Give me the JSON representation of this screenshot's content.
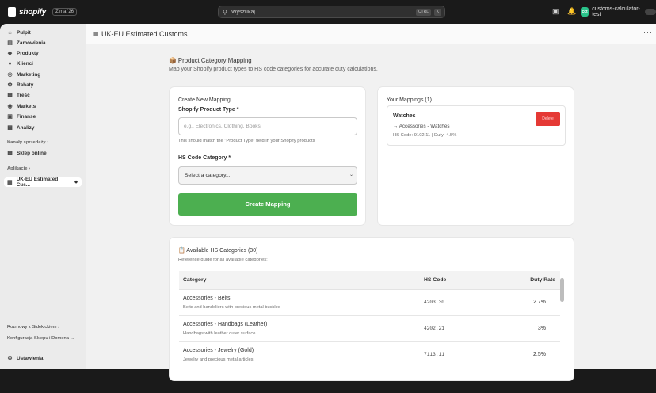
{
  "topbar": {
    "brand": "shopify",
    "edition": "Zima '26",
    "search_placeholder": "Wyszukaj",
    "kbd1": "CTRL",
    "kbd2": "K",
    "store_initials": "cct",
    "store_name": "customs-calculator-test"
  },
  "sidebar": {
    "items": [
      {
        "label": "Pulpit",
        "icon": "home-icon"
      },
      {
        "label": "Zamówienia",
        "icon": "orders-icon"
      },
      {
        "label": "Produkty",
        "icon": "tag-icon"
      },
      {
        "label": "Klienci",
        "icon": "person-icon"
      },
      {
        "label": "Marketing",
        "icon": "target-icon"
      },
      {
        "label": "Rabaty",
        "icon": "discount-icon"
      },
      {
        "label": "Treść",
        "icon": "content-icon"
      },
      {
        "label": "Markets",
        "icon": "globe-icon"
      },
      {
        "label": "Finanse",
        "icon": "bank-icon"
      },
      {
        "label": "Analizy",
        "icon": "chart-icon"
      }
    ],
    "sales_channels_header": "Kanały sprzedaży",
    "online_store": "Sklep online",
    "apps_header": "Aplikacje",
    "active_app": "UK-EU Estimated Cus...",
    "sidekick": "Rozmowy z Sidekickiem",
    "config": "Konfiguracja Sklepu i Domena ...",
    "settings": "Ustawienia"
  },
  "header": {
    "title": "UK-EU Estimated Customs"
  },
  "section": {
    "title": "Product Category Mapping",
    "description": "Map your Shopify product types to HS code categories for accurate duty calculations."
  },
  "create_form": {
    "heading": "Create New Mapping",
    "product_type_label": "Shopify Product Type *",
    "product_type_placeholder": "e.g., Electronics, Clothing, Books",
    "product_type_help": "This should match the \"Product Type\" field in your Shopify products",
    "category_label": "HS Code Category *",
    "category_selected": "Select a category...",
    "submit_label": "Create Mapping"
  },
  "mappings": {
    "heading": "Your Mappings (1)",
    "items": [
      {
        "name": "Watches",
        "category": "→ Accessories - Watches",
        "details": "HS Code: 9102.11 | Duty: 4.5%",
        "delete_label": "Delete"
      }
    ]
  },
  "hs_categories": {
    "heading": "Available HS Categories (30)",
    "subheading": "Reference guide for all available categories:",
    "columns": [
      "Category",
      "HS Code",
      "Duty Rate"
    ],
    "rows": [
      {
        "name": "Accessories - Belts",
        "desc": "Belts and bandoliers with precious metal buckles",
        "code": "4203.30",
        "rate": "2.7%"
      },
      {
        "name": "Accessories - Handbags (Leather)",
        "desc": "Handbags with leather outer surface",
        "code": "4202.21",
        "rate": "3%"
      },
      {
        "name": "Accessories - Jewelry (Gold)",
        "desc": "Jewelry and precious metal articles",
        "code": "7113.11",
        "rate": "2.5%"
      }
    ]
  },
  "colors": {
    "primary_button": "#4caf50",
    "delete_button": "#e53935",
    "topbar": "#1a1a1a"
  }
}
